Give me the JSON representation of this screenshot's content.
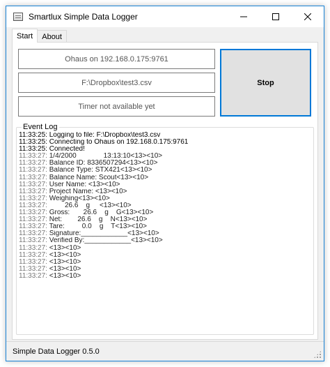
{
  "window": {
    "title": "Smartlux Simple Data Logger",
    "minimize_icon": "minimize-icon",
    "maximize_icon": "maximize-icon",
    "close_icon": "close-icon"
  },
  "tabs": [
    {
      "label": "Start",
      "active": true
    },
    {
      "label": "About",
      "active": false
    }
  ],
  "connection_label": "Ohaus on 192.168.0.175:9761",
  "file_label": "F:\\Dropbox\\test3.csv",
  "timer_label": "Timer not available yet",
  "stop_label": "Stop",
  "event_log": {
    "title": "Event Log",
    "lines": [
      {
        "ts": "11:33:25:",
        "msg": " Logging to file: F:\\Dropbox\\test3.csv",
        "dim": false
      },
      {
        "ts": "11:33:25:",
        "msg": " Connecting to Ohaus on 192.168.0.175:9761",
        "dim": false
      },
      {
        "ts": "11:33:25:",
        "msg": " Connected!",
        "dim": false
      },
      {
        "ts": "11:33:27:",
        "msg": " 1/4/2000              13:13:10<13><10>",
        "dim": true
      },
      {
        "ts": "11:33:27:",
        "msg": " Balance ID: 8336507294<13><10>",
        "dim": true
      },
      {
        "ts": "11:33:27:",
        "msg": " Balance Type: STX421<13><10>",
        "dim": true
      },
      {
        "ts": "11:33:27:",
        "msg": " Balance Name: Scout<13><10>",
        "dim": true
      },
      {
        "ts": "11:33:27:",
        "msg": " User Name: <13><10>",
        "dim": true
      },
      {
        "ts": "11:33:27:",
        "msg": " Project Name: <13><10>",
        "dim": true
      },
      {
        "ts": "11:33:27:",
        "msg": " Weighing<13><10>",
        "dim": true
      },
      {
        "ts": "11:33:27:",
        "msg": "         26.6    g     <13><10>",
        "dim": true
      },
      {
        "ts": "11:33:27:",
        "msg": " Gross:       26.6    g    G<13><10>",
        "dim": true
      },
      {
        "ts": "11:33:27:",
        "msg_pre": " Net:        ",
        "msg_hl": "26.6",
        "msg_post": "    g    N<13><10>",
        "dim": true
      },
      {
        "ts": "11:33:27:",
        "msg": " Tare:         0.0    g    T<13><10>",
        "dim": true
      },
      {
        "ts": "11:33:27:",
        "msg": " Signature:____________<13><10>",
        "dim": true
      },
      {
        "ts": "11:33:27:",
        "msg": " Verified By:____________<13><10>",
        "dim": true
      },
      {
        "ts": "11:33:27:",
        "msg": " <13><10>",
        "dim": true
      },
      {
        "ts": "11:33:27:",
        "msg": " <13><10>",
        "dim": true
      },
      {
        "ts": "11:33:27:",
        "msg": " <13><10>",
        "dim": true
      },
      {
        "ts": "11:33:27:",
        "msg": " <13><10>",
        "dim": true
      },
      {
        "ts": "11:33:27:",
        "msg": " <13><10>",
        "dim": true
      }
    ]
  },
  "status": "Simple Data Logger 0.5.0",
  "colors": {
    "accent": "#0078d7",
    "window_border": "#1883d7",
    "highlight_value": "#2f86d6"
  }
}
